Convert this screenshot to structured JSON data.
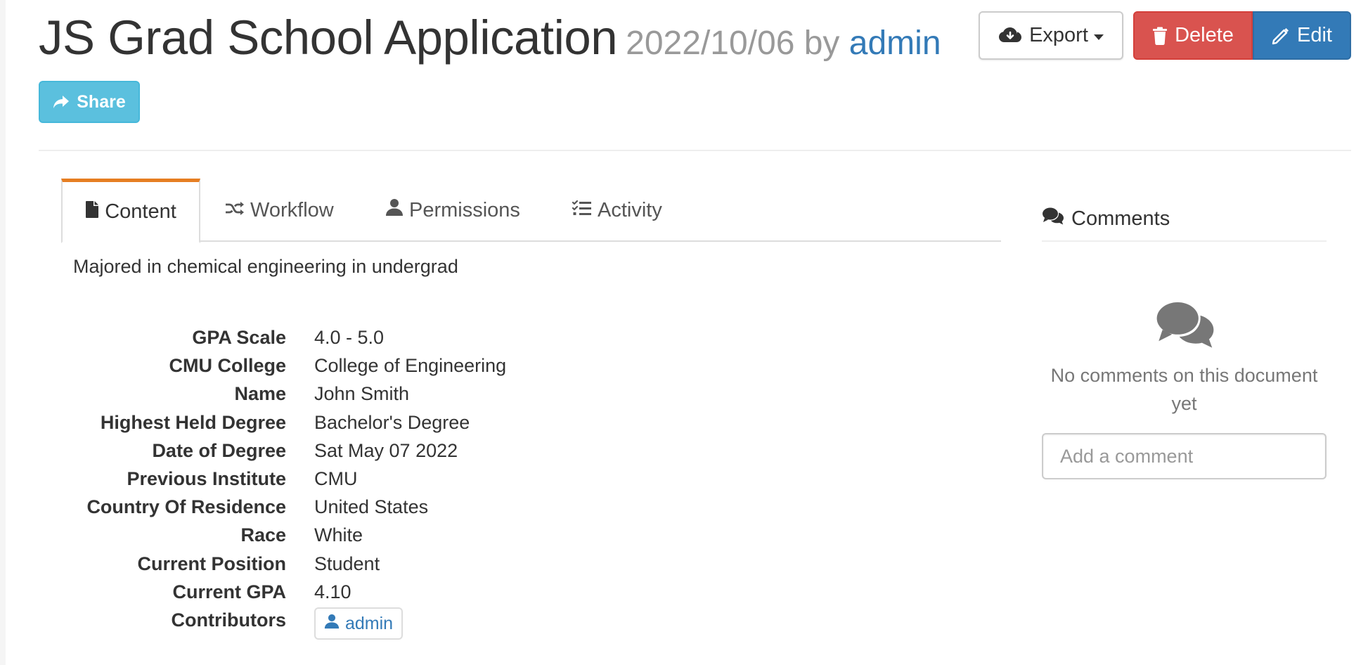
{
  "header": {
    "title": "JS Grad School Application",
    "date": "2022/10/06",
    "by": "by",
    "author": "admin"
  },
  "actions": {
    "export_label": "Export",
    "delete_label": "Delete",
    "edit_label": "Edit",
    "share_label": "Share"
  },
  "tabs": [
    {
      "label": "Content",
      "active": true,
      "icon": "file-icon"
    },
    {
      "label": "Workflow",
      "active": false,
      "icon": "shuffle-icon"
    },
    {
      "label": "Permissions",
      "active": false,
      "icon": "user-icon"
    },
    {
      "label": "Activity",
      "active": false,
      "icon": "list-check-icon"
    }
  ],
  "content": {
    "summary": "Majored in chemical engineering in undergrad",
    "fields": [
      {
        "key": "GPA Scale",
        "value": "4.0 - 5.0"
      },
      {
        "key": "CMU College",
        "value": "College of Engineering"
      },
      {
        "key": "Name",
        "value": "John Smith"
      },
      {
        "key": "Highest Held Degree",
        "value": "Bachelor's Degree"
      },
      {
        "key": "Date of Degree",
        "value": "Sat May 07 2022"
      },
      {
        "key": "Previous Institute",
        "value": "CMU"
      },
      {
        "key": "Country Of Residence",
        "value": "United States"
      },
      {
        "key": "Race",
        "value": "White"
      },
      {
        "key": "Current Position",
        "value": "Student"
      },
      {
        "key": "Current GPA",
        "value": "4.10"
      }
    ],
    "contributors_label": "Contributors",
    "contributors": [
      "admin"
    ]
  },
  "comments": {
    "heading": "Comments",
    "empty_text": "No comments on this document yet",
    "input_placeholder": "Add a comment"
  },
  "colors": {
    "danger": "#d9534f",
    "primary": "#337ab7",
    "info": "#5bc0de",
    "active_tab_accent": "#e67e22"
  }
}
